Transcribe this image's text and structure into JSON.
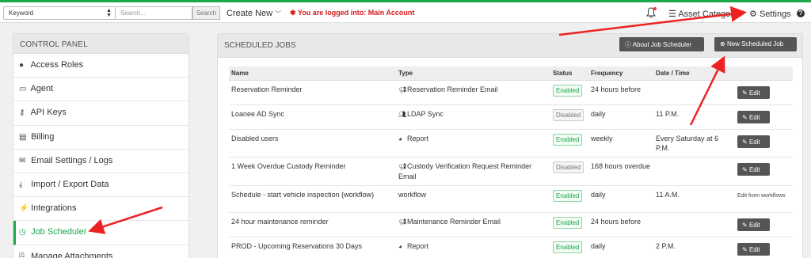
{
  "topbar": {
    "keyword_select": "Keyword",
    "search_placeholder": "Search...",
    "search_button": "Search",
    "create_new": "Create New",
    "logged_in": "You are logged into: Main Account",
    "asset_categories": "Asset Categories",
    "settings": "Settings",
    "help": "?"
  },
  "control_panel": {
    "title": "CONTROL PANEL",
    "items": [
      {
        "icon": "user-icon",
        "label": "Access Roles"
      },
      {
        "icon": "monitor-icon",
        "label": "Agent"
      },
      {
        "icon": "key-icon",
        "label": "API Keys"
      },
      {
        "icon": "billing-icon",
        "label": "Billing"
      },
      {
        "icon": "envelope-icon",
        "label": "Email Settings / Logs"
      },
      {
        "icon": "download-icon",
        "label": "Import / Export Data"
      },
      {
        "icon": "plug-icon",
        "label": "Integrations"
      },
      {
        "icon": "clock-icon",
        "label": "Job Scheduler",
        "active": true
      },
      {
        "icon": "paperclip-icon",
        "label": "Manage Attachments"
      }
    ]
  },
  "scheduled_jobs": {
    "title": "SCHEDULED JOBS",
    "about_button": "About Job Scheduler",
    "new_button": "New Scheduled Job",
    "columns": [
      "Name",
      "Type",
      "Status",
      "Frequency",
      "Date / Time"
    ],
    "rows": [
      {
        "name": "Reservation Reminder",
        "type_icon": "megaphone-icon",
        "type": "Reservation Reminder Email",
        "status": "Enabled",
        "frequency": "24 hours before",
        "datetime": "",
        "action": "Edit"
      },
      {
        "name": "Loanee AD Sync",
        "type_icon": "users-icon",
        "type": "LDAP Sync",
        "status": "Disabled",
        "frequency": "daily",
        "datetime": "11 P.M.",
        "action": "Edit"
      },
      {
        "name": "Disabled users",
        "type_icon": "pie-chart-icon",
        "type": "Report",
        "status": "Enabled",
        "frequency": "weekly",
        "datetime": "Every Saturday at 6 P.M.",
        "action": "Edit"
      },
      {
        "name": "1 Week Overdue Custody Reminder",
        "type_icon": "megaphone-icon",
        "type": "Custody Verification Request Reminder Email",
        "status": "Disabled",
        "frequency": "168 hours overdue",
        "datetime": "",
        "action": "Edit"
      },
      {
        "name": "Schedule - start vehicle inspection (workflow)",
        "type_icon": "",
        "type": "workflow",
        "status": "Enabled",
        "frequency": "daily",
        "datetime": "11 A.M.",
        "action": "Edit from workflows"
      },
      {
        "name": "24 hour maintenance reminder",
        "type_icon": "megaphone-icon",
        "type": "Maintenance Reminder Email",
        "status": "Enabled",
        "frequency": "24 hours before",
        "datetime": "",
        "action": "Edit"
      },
      {
        "name": "PROD - Upcoming Reservations 30 Days",
        "type_icon": "pie-chart-icon",
        "type": "Report",
        "status": "Enabled",
        "frequency": "daily",
        "datetime": "2 P.M.",
        "action": "Edit"
      }
    ]
  },
  "colors": {
    "accent": "#1aa84a",
    "alert": "#d41b1b",
    "annotation": "#ee2222",
    "dark_button": "#555555"
  }
}
